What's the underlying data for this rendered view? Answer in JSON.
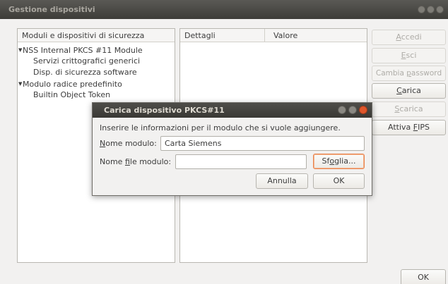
{
  "window": {
    "title": "Gestione dispositivi"
  },
  "tree_pane": {
    "header": "Moduli e dispositivi di sicurezza",
    "nodes": [
      {
        "label": "NSS Internal PKCS #11 Module",
        "expanded": true
      },
      {
        "label": "Servizi crittografici generici"
      },
      {
        "label": "Disp. di sicurezza software"
      },
      {
        "label": "Modulo radice predefinito",
        "expanded": true
      },
      {
        "label": "Builtin Object Token"
      }
    ]
  },
  "detail_pane": {
    "col_details": "Dettagli",
    "col_value": "Valore"
  },
  "side_buttons": {
    "login": {
      "pre": "",
      "key": "A",
      "post": "ccedi",
      "enabled": false
    },
    "logout": {
      "pre": "",
      "key": "E",
      "post": "sci",
      "enabled": false
    },
    "change_password": {
      "pre": "Cambia ",
      "key": "p",
      "post": "assword",
      "enabled": false
    },
    "load": {
      "pre": "",
      "key": "C",
      "post": "arica",
      "enabled": true
    },
    "unload": {
      "pre": "",
      "key": "S",
      "post": "carica",
      "enabled": false
    },
    "enable_fips": {
      "pre": "Attiva ",
      "key": "F",
      "post": "IPS",
      "enabled": true
    }
  },
  "ok_label": "OK",
  "dialog": {
    "title": "Carica dispositivo PKCS#11",
    "instructions": "Inserire le informazioni per il modulo che si vuole aggiungere.",
    "module_name": {
      "key": "N",
      "rest": "ome modulo:",
      "value": "Carta Siemens"
    },
    "module_file": {
      "pre": "Nome ",
      "key": "f",
      "post": "ile modulo:",
      "value": ""
    },
    "browse": {
      "pre": "Sf",
      "key": "o",
      "post": "glia..."
    },
    "cancel_label": "Annulla",
    "ok_label": "OK"
  }
}
